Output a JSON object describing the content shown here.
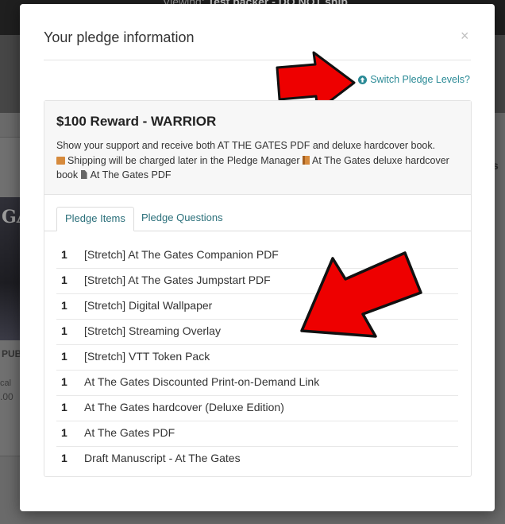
{
  "background": {
    "viewing_prefix": "Viewing:",
    "viewing_name": "Test backer - DO NOT ship",
    "partial_pub": "PUB",
    "partial_cal": "cal",
    "partial_price": ".00",
    "partial_right": "s"
  },
  "modal": {
    "title": "Your pledge information",
    "close": "×",
    "switch_link": "Switch Pledge Levels?",
    "reward": {
      "title": "$100 Reward - WARRIOR",
      "desc_intro": "Show your support and receive both AT THE GATES PDF and deluxe hardcover book.",
      "shipping_note": "Shipping will be charged later in the Pledge Manager",
      "item_hardcover": "At The Gates deluxe hardcover book",
      "item_pdf": "At The Gates PDF"
    },
    "tabs": [
      {
        "label": "Pledge Items"
      },
      {
        "label": "Pledge Questions"
      }
    ],
    "items": [
      {
        "qty": "1",
        "name": "[Stretch] At The Gates Companion PDF"
      },
      {
        "qty": "1",
        "name": "[Stretch] At The Gates Jumpstart PDF"
      },
      {
        "qty": "1",
        "name": "[Stretch] Digital Wallpaper"
      },
      {
        "qty": "1",
        "name": "[Stretch] Streaming Overlay"
      },
      {
        "qty": "1",
        "name": "[Stretch] VTT Token Pack"
      },
      {
        "qty": "1",
        "name": "At The Gates Discounted Print-on-Demand Link"
      },
      {
        "qty": "1",
        "name": "At The Gates hardcover (Deluxe Edition)"
      },
      {
        "qty": "1",
        "name": "At The Gates PDF"
      },
      {
        "qty": "1",
        "name": "Draft Manuscript - At The Gates"
      }
    ]
  },
  "colors": {
    "link": "#2a8a96",
    "arrow_fill": "#ee0000",
    "arrow_outline": "#111111"
  }
}
